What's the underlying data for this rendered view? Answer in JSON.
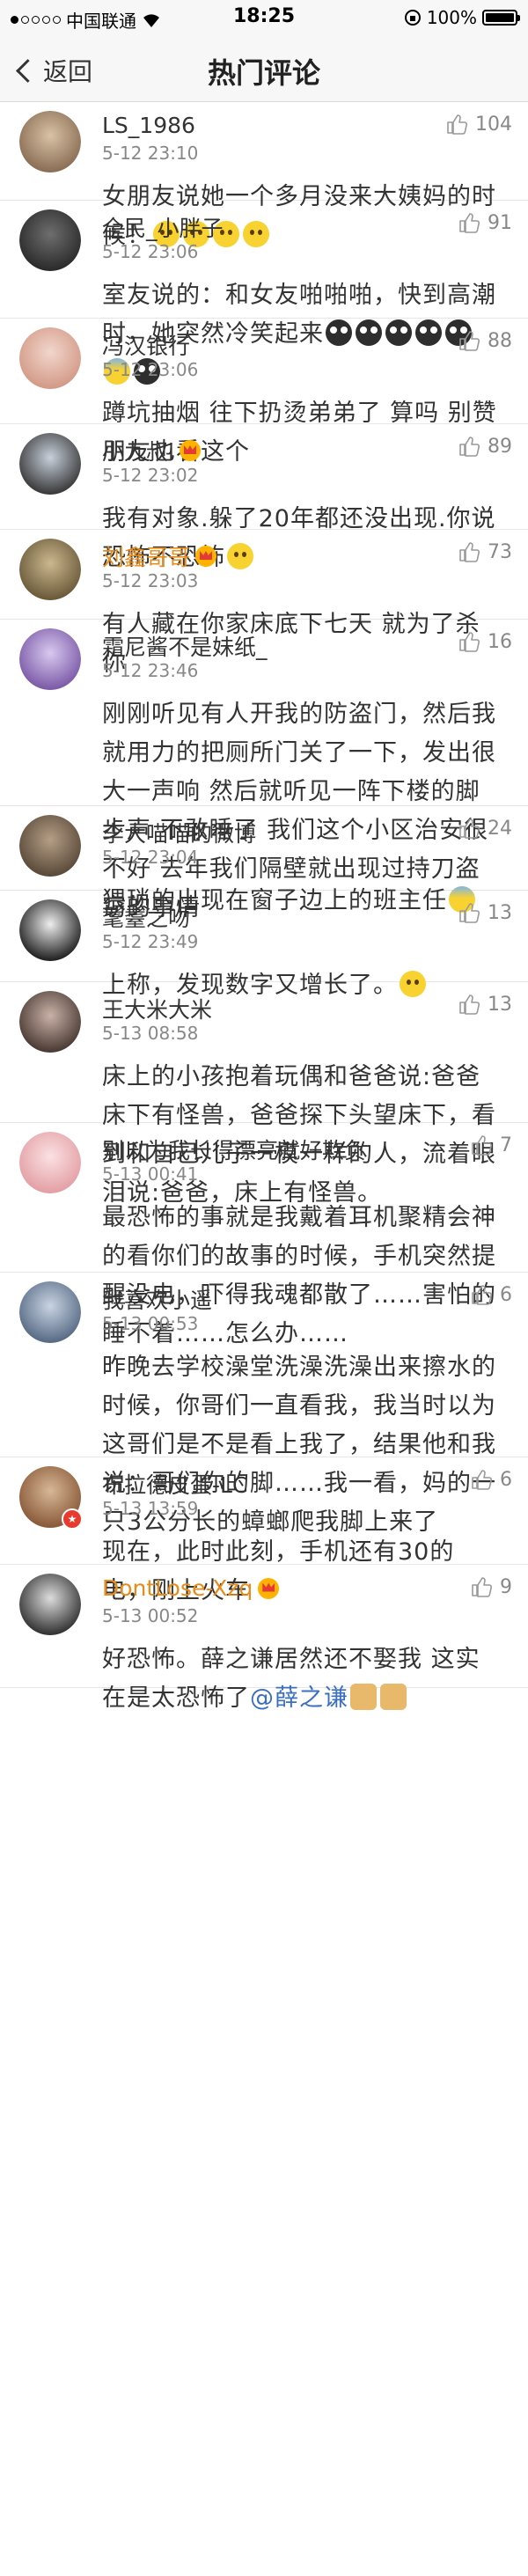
{
  "status": {
    "carrier": "中国联通",
    "time": "18:25",
    "battery": "100%",
    "battery_level": 1.0
  },
  "nav": {
    "back": "返回",
    "title": "热门评论"
  },
  "comments": [
    {
      "user": "LS_1986",
      "time": "5-12 23:10",
      "likes": "104",
      "text": "女朋友说她一个多月没来大姨妈的时候！",
      "emoji": [
        "yellow",
        "yellow",
        "yellow",
        "yellow"
      ],
      "gold": false,
      "crown": false
    },
    {
      "user": "全民_小胖子",
      "time": "5-12 23:06",
      "likes": "91",
      "text": "室友说的：和女友啪啪啪，快到高潮时，她突然冷笑起来",
      "emoji": [
        "dark",
        "dark",
        "dark",
        "dark",
        "dark",
        "blue",
        "dark"
      ],
      "gold": false,
      "crown": false
    },
    {
      "user": "冯汉银行",
      "time": "5-12 23:06",
      "likes": "88",
      "text": "蹲坑抽烟 往下扔烫弟弟了 算吗 别赞朋友也看这个",
      "emoji": [],
      "gold": false,
      "crown": false
    },
    {
      "user": "小九叔i",
      "time": "5-12 23:02",
      "likes": "89",
      "text": "我有对象.躲了20年都还没出现.你说恐怖不恐怖",
      "emoji": [
        "yellow"
      ],
      "gold": false,
      "crown": true
    },
    {
      "user": "刘鑫哥哥",
      "time": "5-12 23:03",
      "likes": "73",
      "text": "有人藏在你家床底下七天 就为了杀你",
      "emoji": [],
      "gold": true,
      "crown": true
    },
    {
      "user": "霜尼酱不是妹纸_",
      "time": "5-12 23:46",
      "likes": "16",
      "text": "刚刚听见有人开我的防盗门，然后我就用力的把厕所门关了一下，发出很大一声响 然后就听见一阵下楼的脚步声 不敢睡了 我们这个小区治安很不好 去年我们隔壁就出现过持刀盗窃的事情",
      "emoji": [],
      "gold": false,
      "crown": false
    },
    {
      "user": "李大喵喵的微博",
      "time": "5-12 23:04",
      "likes": "24",
      "text": "猥琐的出现在窗子边上的班主任",
      "emoji": [
        "blue"
      ],
      "gold": false,
      "crown": false
    },
    {
      "user": "耄耋之吻",
      "time": "5-12 23:49",
      "likes": "13",
      "text": "上称，发现数字又增长了。",
      "emoji": [
        "yellow"
      ],
      "gold": false,
      "crown": false
    },
    {
      "user": "王大米大米",
      "time": "5-13 08:58",
      "likes": "13",
      "text": "床上的小孩抱着玩偶和爸爸说:爸爸床下有怪兽，爸爸探下头望床下，看到和自己儿子一模一样的人，流着眼泪说:爸爸，床上有怪兽。",
      "emoji": [],
      "gold": false,
      "crown": false
    },
    {
      "user": "别以为我长得漂亮就好欺负",
      "time": "5-13 00:41",
      "likes": "7",
      "text": "最恐怖的事就是我戴着耳机聚精会神的看你们的故事的时候，手机突然提醒没电，吓得我魂都散了……害怕的睡不着……怎么办……",
      "emoji": [],
      "gold": false,
      "crown": false
    },
    {
      "user": "我喜欢小遥",
      "time": "5-13 00:53",
      "likes": "6",
      "text": "昨晚去学校澡堂洗澡洗澡出来擦水的时候，你哥们一直看我，我当时以为这哥们是不是看上我了，结果他和我说：哥们你的脚……我一看，妈的一只3公分长的蟑螂爬我脚上来了",
      "emoji": [],
      "gold": false,
      "crown": false
    },
    {
      "user": "布拉德皮蛋-LC",
      "time": "5-13 13:59",
      "likes": "6",
      "text": "现在，此时此刻，手机还有30的电，刚上火车",
      "emoji": [],
      "gold": false,
      "crown": false
    },
    {
      "user": "DontLose-Xzq",
      "time": "5-13 00:52",
      "likes": "9",
      "text": "好恐怖。薛之谦居然还不娶我 这实在是太恐怖了",
      "mention": "@薛之谦",
      "emoji": [
        "doge",
        "doge"
      ],
      "gold": true,
      "crown": true
    }
  ],
  "colors": {
    "accent_gold": "#e88b19",
    "text": "#333333",
    "meta": "#888888",
    "link": "#3b6fc1"
  }
}
